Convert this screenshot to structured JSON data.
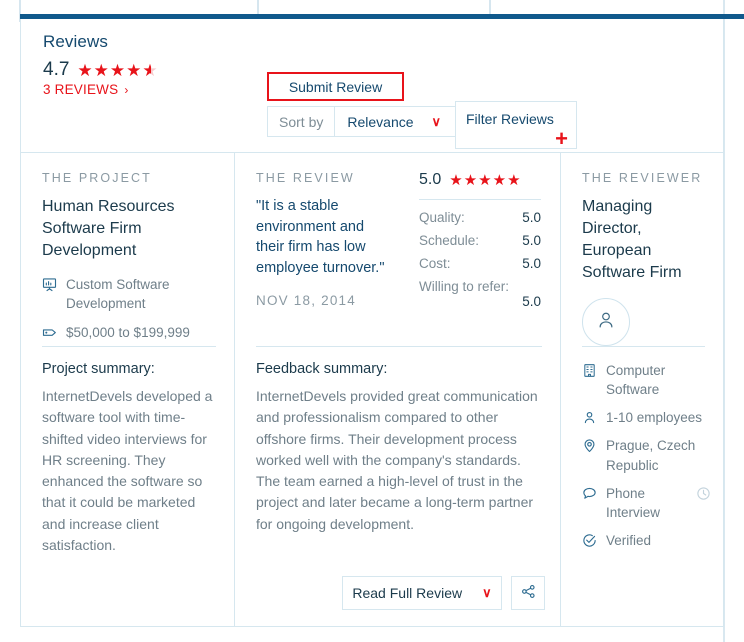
{
  "header": {
    "title": "Reviews",
    "score": "4.7",
    "stars_filled": 4,
    "stars_half": true,
    "reviews_link": "3 REVIEWS",
    "chevron": "›",
    "submit_label": "Submit Review",
    "sort_label": "Sort by",
    "sort_value": "Relevance",
    "sort_caret": "∨",
    "filter_label": "Filter Reviews",
    "filter_plus": "+"
  },
  "project": {
    "eyebrow": "THE PROJECT",
    "title": "Human Resources Software Firm Development",
    "meta": [
      {
        "icon": "presentation-chart-icon",
        "text": "Custom Software Development"
      },
      {
        "icon": "price-tag-icon",
        "text": "$50,000 to $199,999"
      }
    ],
    "summary_heading": "Project summary:",
    "summary_text": "InternetDevels developed a software tool with time-shifted video interviews for HR screening. They enhanced the software so that it could be marketed and increase client satisfaction."
  },
  "review": {
    "eyebrow": "THE REVIEW",
    "quote": "\"It is a stable environment and their firm has low employee turnover.\"",
    "date": "NOV 18, 2014",
    "overall_score": "5.0",
    "overall_stars": 5,
    "ratings": [
      {
        "label": "Quality:",
        "value": "5.0",
        "wrap": false
      },
      {
        "label": "Schedule:",
        "value": "5.0",
        "wrap": false
      },
      {
        "label": "Cost:",
        "value": "5.0",
        "wrap": false
      },
      {
        "label": "Willing to refer:",
        "value": "5.0",
        "wrap": true
      }
    ],
    "summary_heading": "Feedback summary:",
    "summary_text": "InternetDevels provided great communication and professionalism compared to other offshore firms. Their development process worked well with the company's standards. The team earned a high-level of trust in the project and later became a long-term partner for ongoing development.",
    "read_label": "Read Full Review",
    "read_caret": "∨",
    "share_icon": "share-icon"
  },
  "reviewer": {
    "eyebrow": "THE REVIEWER",
    "name": "Managing Director, European Software Firm",
    "avatar_icon": "person-avatar-icon",
    "meta": [
      {
        "icon": "building-icon",
        "text": "Computer Software"
      },
      {
        "icon": "person-icon",
        "text": "1-10 employees"
      },
      {
        "icon": "location-pin-icon",
        "text": "Prague, Czech Republic"
      },
      {
        "icon": "speech-bubble-icon",
        "text": "Phone Interview",
        "trailing_icon": "clock-icon"
      },
      {
        "icon": "check-circle-icon",
        "text": "Verified"
      }
    ]
  },
  "colors": {
    "accent_red": "#e8131a",
    "brand_blue": "#15496e",
    "rule_blue": "#10598c",
    "border": "#d6e7ef",
    "muted_text": "#6f7f89"
  }
}
